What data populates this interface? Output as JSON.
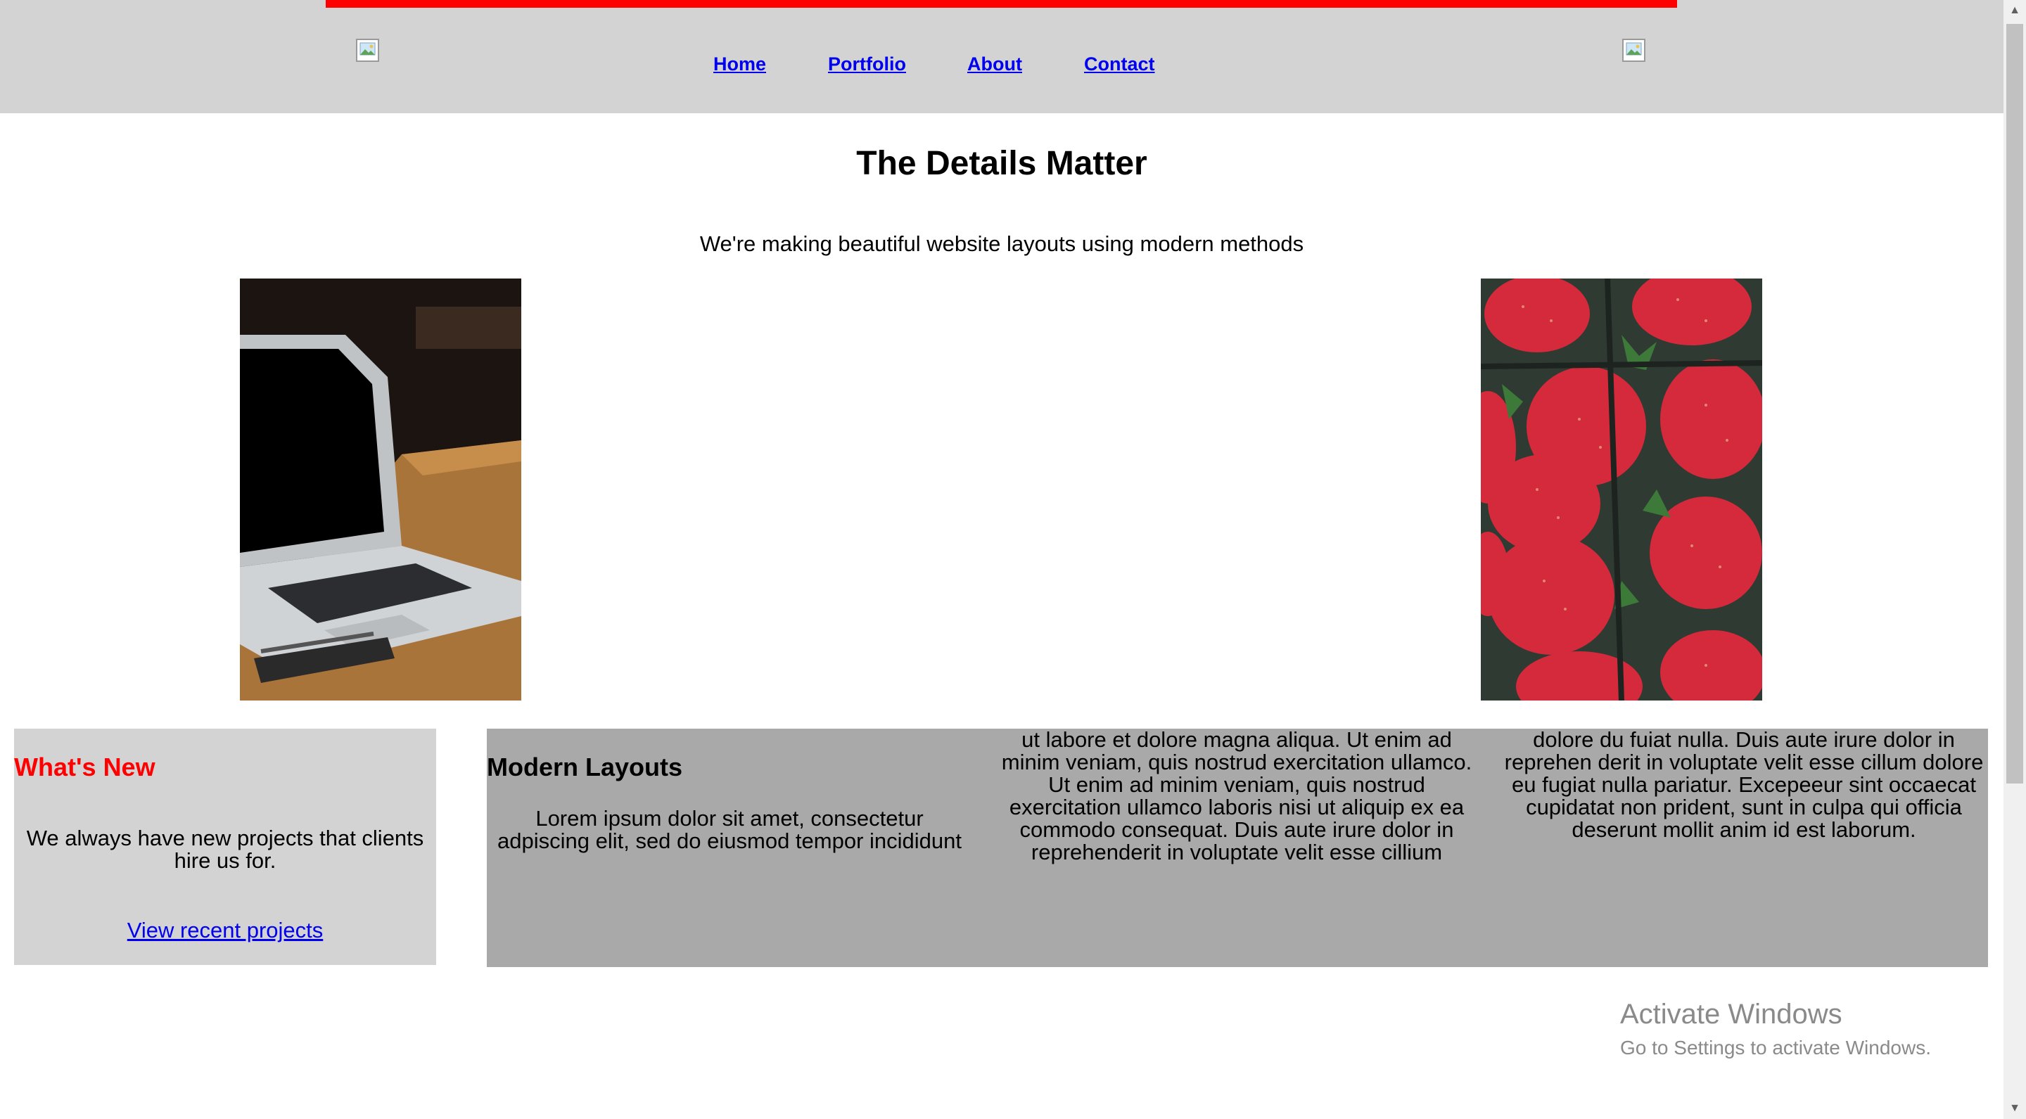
{
  "header": {
    "accent_color": "#ff0000",
    "nav": [
      {
        "label": "Home"
      },
      {
        "label": "Portfolio"
      },
      {
        "label": "About"
      },
      {
        "label": "Contact"
      }
    ],
    "logo_left_icon": "broken-image-icon",
    "logo_right_icon": "broken-image-icon"
  },
  "hero": {
    "title": "The Details Matter",
    "subtitle": "We're making beautiful website layouts using modern methods"
  },
  "images": {
    "left": "laptop-photo",
    "right": "strawberries-photo"
  },
  "whats_new": {
    "heading": "What's New",
    "text": "We always have new projects that clients hire us for.",
    "link": "View recent projects"
  },
  "modern_layouts": {
    "heading": "Modern Layouts",
    "col1": "Lorem ipsum dolor sit amet, consectetur adpiscing elit, sed do eiusmod tempor incididunt",
    "col2": "ut labore et dolore magna aliqua. Ut enim ad minim veniam, quis nostrud exercitation ullamco. Ut enim ad minim veniam, quis nostrud exercitation ullamco laboris nisi ut aliquip ex ea commodo consequat. Duis aute irure dolor in reprehenderit in voluptate velit esse cillium",
    "col3": "dolore du fuiat nulla. Duis aute irure dolor in reprehen derit in voluptate velit esse cillum dolore eu fugiat nulla pariatur. Excepeeur sint occaecat cupidatat non prident, sunt in culpa qui officia deserunt mollit anim id est laborum."
  },
  "watermark": {
    "title": "Activate Windows",
    "subtitle": "Go to Settings to activate Windows."
  },
  "colors": {
    "header_bg": "#d3d3d3",
    "box_new_bg": "#d3d3d3",
    "box_modern_bg": "#a9a9a9",
    "link": "#0000ee",
    "heading_red": "#ff0000"
  }
}
